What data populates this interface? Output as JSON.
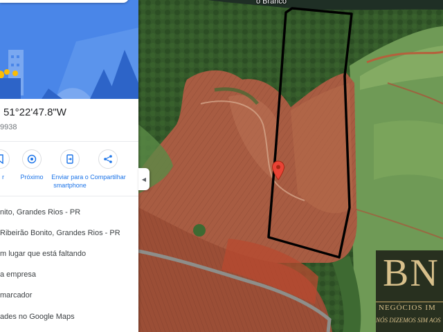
{
  "map": {
    "road_label": "o Branco",
    "marker": "red-location-pin-icon"
  },
  "panel": {
    "coordinates": "51°22'47.8\"W",
    "plus_code": "9938",
    "actions": [
      {
        "label": "r",
        "icon": "save-icon"
      },
      {
        "label": "Próximo",
        "icon": "nearby-icon"
      },
      {
        "label": "Enviar para o smartphone",
        "icon": "send-to-phone-icon"
      },
      {
        "label": "Compartilhar",
        "icon": "share-icon"
      }
    ],
    "rows": [
      "nito, Grandes Rios - PR",
      "Ribeirão Bonito, Grandes Rios - PR",
      "m lugar que está faltando",
      "a empresa",
      "marcador",
      "ades no Google Maps"
    ]
  },
  "brand": {
    "mark": "BN",
    "name": "NEGÓCIOS IM",
    "slogan": "NÓS DIZEMOS SIM AOS",
    "accent": "#d8c08b"
  },
  "colors": {
    "ui_blue": "#1a73e8",
    "hero_blue": "#4a86e8",
    "boundary": "#000000"
  }
}
